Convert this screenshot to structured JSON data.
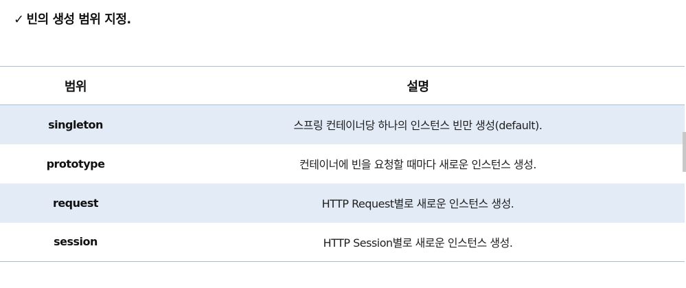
{
  "heading": {
    "check": "✓",
    "title": "빈의 생성 범위 지정."
  },
  "table": {
    "headers": {
      "scope": "범위",
      "description": "설명"
    },
    "rows": [
      {
        "scope": "singleton",
        "description": "스프링 컨테이너당 하나의 인스턴스 빈만 생성(default)."
      },
      {
        "scope": "prototype",
        "description": "컨테이너에 빈을 요청할 때마다 새로운 인스턴스 생성."
      },
      {
        "scope": "request",
        "description": "HTTP Request별로 새로운 인스턴스 생성."
      },
      {
        "scope": "session",
        "description": "HTTP Session별로 새로운 인스턴스 생성."
      }
    ],
    "row_shade_color": "#e3ecf6",
    "border_color": "#a9bfd8"
  }
}
